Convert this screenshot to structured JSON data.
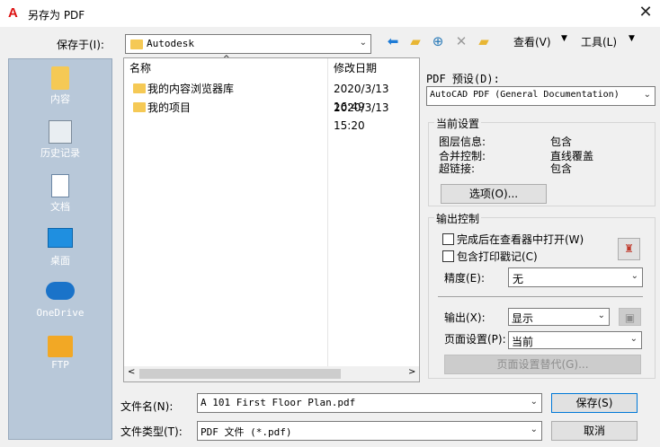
{
  "window": {
    "title": "另存为 PDF",
    "close_icon": "close-icon"
  },
  "savein": {
    "label": "保存于(I):",
    "value": "Autodesk"
  },
  "toolbar": {
    "view_label": "查看(V)",
    "tools_label": "工具(L)"
  },
  "places": [
    {
      "label": "内容",
      "icon": "folder-icon"
    },
    {
      "label": "历史记录",
      "icon": "history-icon"
    },
    {
      "label": "文档",
      "icon": "document-icon"
    },
    {
      "label": "桌面",
      "icon": "desktop-icon"
    },
    {
      "label": "OneDrive",
      "icon": "cloud-icon"
    },
    {
      "label": "FTP",
      "icon": "ftp-folder-icon"
    }
  ],
  "filelist": {
    "columns": [
      "名称",
      "修改日期"
    ],
    "rows": [
      {
        "name": "我的内容浏览器库",
        "date": "2020/3/13 16:49"
      },
      {
        "name": "我的项目",
        "date": "2020/3/13 15:20"
      }
    ]
  },
  "pdf": {
    "preset_label": "PDF 预设(D):",
    "preset_value": "AutoCAD PDF (General Documentation)",
    "current_group": "当前设置",
    "settings": [
      {
        "k": "图层信息:",
        "v": "包含"
      },
      {
        "k": "合并控制:",
        "v": "直线覆盖"
      },
      {
        "k": "超链接:",
        "v": "包含"
      }
    ],
    "options_btn": "选项(O)...",
    "output_group": "输出控制",
    "open_viewer": "完成后在查看器中打开(W)",
    "include_stamp": "包含打印戳记(C)",
    "precision_label": "精度(E):",
    "precision_value": "无",
    "output_label": "输出(X):",
    "output_value": "显示",
    "pagesetup_label": "页面设置(P):",
    "pagesetup_value": "当前",
    "pagesetup_override": "页面设置替代(G)..."
  },
  "filename": {
    "label": "文件名(N):",
    "value": "A 101 First Floor Plan.pdf"
  },
  "filetype": {
    "label": "文件类型(T):",
    "value": "PDF 文件 (*.pdf)"
  },
  "buttons": {
    "save": "保存(S)",
    "cancel": "取消"
  }
}
